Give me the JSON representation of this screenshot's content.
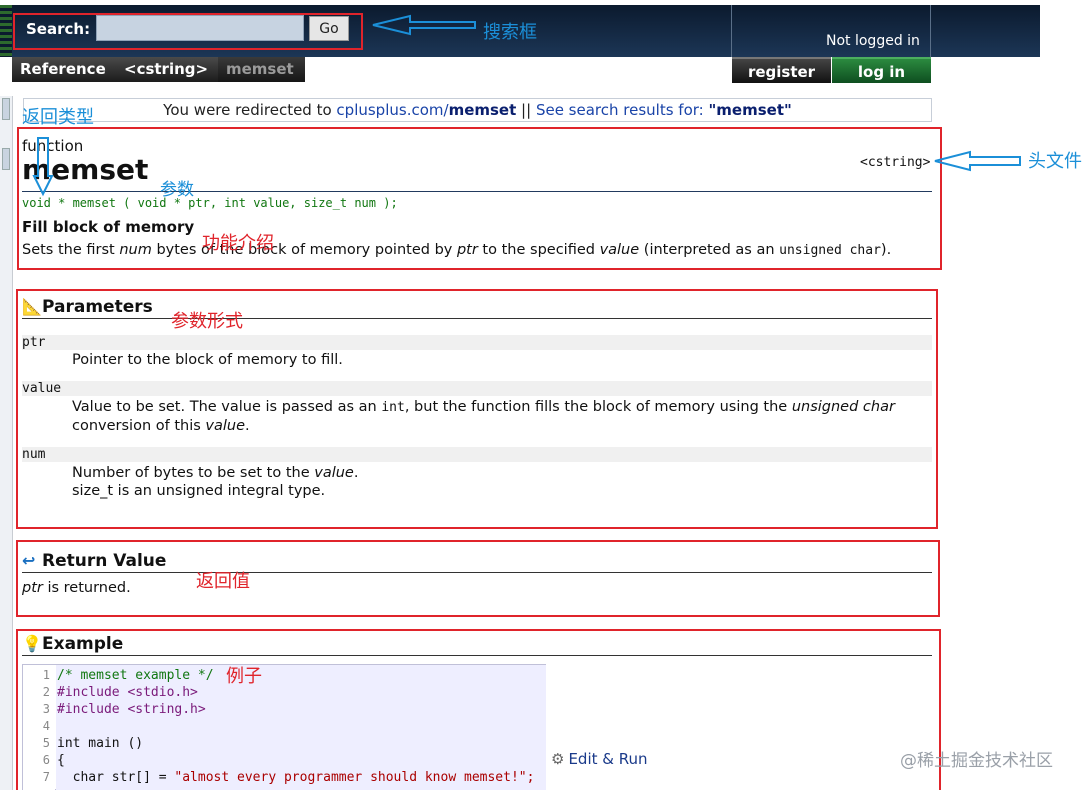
{
  "header": {
    "search_label": "Search:",
    "search_value": "",
    "go_label": "Go",
    "login_status": "Not logged in",
    "register_label": "register",
    "login_label": "log in"
  },
  "breadcrumb": [
    "Reference",
    "<cstring>",
    "memset"
  ],
  "redirect": {
    "prefix": "You were redirected to ",
    "site": "cplusplus.com/",
    "page": "memset",
    "separator": " || ",
    "see_results": "See search results for: ",
    "query": "\"memset\""
  },
  "function": {
    "kind": "function",
    "name": "memset",
    "header_file": "<cstring>",
    "prototype": "void * memset ( void * ptr, int value, size_t num );",
    "summary": "Fill block of memory",
    "description": {
      "p1": "Sets the first ",
      "num": "num",
      "p2": " bytes of the block of memory pointed by ",
      "ptr": "ptr",
      "p3": " to the specified ",
      "value": "value",
      "p4": " (interpreted as an ",
      "type": "unsigned char",
      "p5": ")."
    }
  },
  "parameters": {
    "title": "Parameters",
    "ptr_name": "ptr",
    "ptr_desc": "Pointer to the block of memory to fill.",
    "value_name": "value",
    "value_desc": {
      "p1": "Value to be set. The value is passed as an ",
      "int": "int",
      "p2": ", but the function fills the block of memory using the ",
      "uc": "unsigned char",
      "p3": "conversion of this ",
      "value": "value",
      "p4": "."
    },
    "num_name": "num",
    "num_desc": {
      "p1": "Number of bytes to be set to the ",
      "value": "value",
      "p2": "."
    },
    "num_note": "size_t is an unsigned integral type."
  },
  "return_value": {
    "title": "Return Value",
    "ptr": "ptr",
    "text": " is returned."
  },
  "example": {
    "title": "Example",
    "lines": [
      {
        "n": "1",
        "text": "/* memset example */",
        "cls": "c-comment"
      },
      {
        "n": "2",
        "text": "#include <stdio.h>",
        "cls": "c-pre"
      },
      {
        "n": "3",
        "text": "#include <string.h>",
        "cls": "c-pre"
      },
      {
        "n": "4",
        "text": "",
        "cls": ""
      },
      {
        "n": "5",
        "text": "int main ()",
        "cls": ""
      },
      {
        "n": "6",
        "text": "{",
        "cls": ""
      },
      {
        "n": "7",
        "text": "  char str[] = ",
        "cls": "",
        "str": "\"almost every programmer should know memset!\";"
      }
    ],
    "edit_run": "Edit & Run"
  },
  "annotations": {
    "search_box": "搜索框",
    "return_type": "返回类型",
    "params": "参数",
    "header_file": "头文件",
    "function_intro": "功能介绍",
    "param_form": "参数形式",
    "return_value": "返回值",
    "example": "例子"
  },
  "watermark": "@稀土掘金技术社区",
  "colors": {
    "annotation_red": "#e0242b",
    "annotation_blue": "#1b8fd8",
    "header_bg": "#0b1a2e",
    "login_green": "#1a6b30",
    "prototype_green": "#117711"
  }
}
